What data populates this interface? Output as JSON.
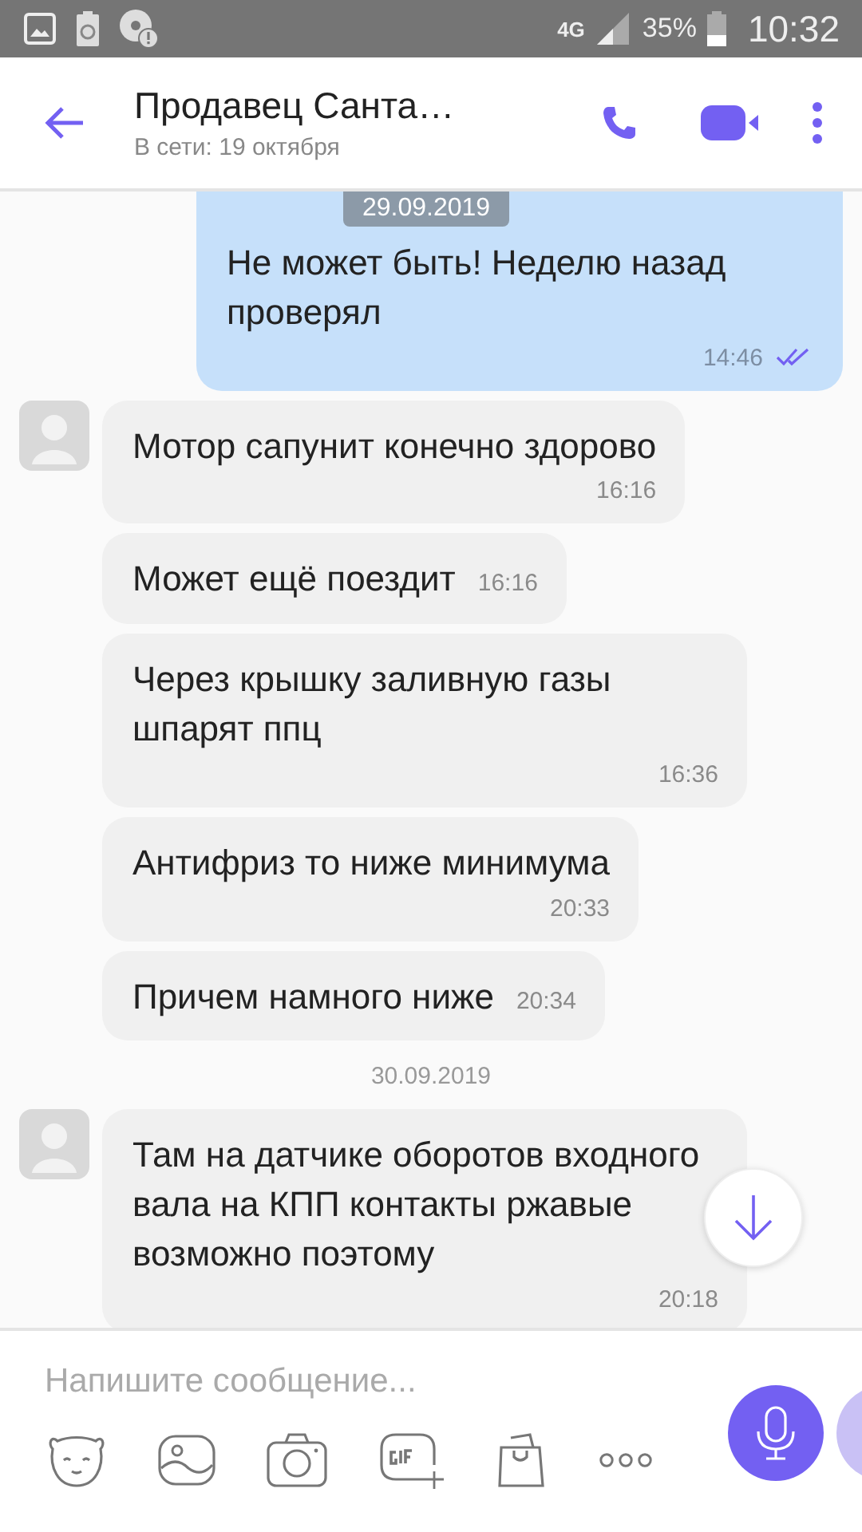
{
  "status_bar": {
    "network": "4G",
    "battery": "35%",
    "time": "10:32"
  },
  "header": {
    "title": "Продавец Санта…",
    "subtitle": "В сети: 19 октября"
  },
  "sticky_date": "29.09.2019",
  "messages": [
    {
      "kind": "outgoing",
      "text": "Не может быть! Неделю назад проверял",
      "time": "14:46",
      "read": true
    },
    {
      "kind": "incoming",
      "avatar": true,
      "text": "Мотор сапунит конечно здорово",
      "time": "16:16"
    },
    {
      "kind": "incoming",
      "avatar": false,
      "text": "Может ещё поездит",
      "time": "16:16"
    },
    {
      "kind": "incoming",
      "avatar": false,
      "text": "Через крышку заливную газы шпарят ппц",
      "time": "16:36"
    },
    {
      "kind": "incoming",
      "avatar": false,
      "text": "Антифриз то ниже минимума",
      "time": "20:33"
    },
    {
      "kind": "incoming",
      "avatar": false,
      "text": "Причем намного ниже",
      "time": "20:34"
    },
    {
      "kind": "date",
      "text": "30.09.2019"
    },
    {
      "kind": "incoming",
      "avatar": true,
      "text": "Там на датчике оборотов входного вала на КПП контакты ржавые возможно поэтому",
      "time": "20:18"
    }
  ],
  "composer": {
    "placeholder": "Напишите сообщение..."
  }
}
